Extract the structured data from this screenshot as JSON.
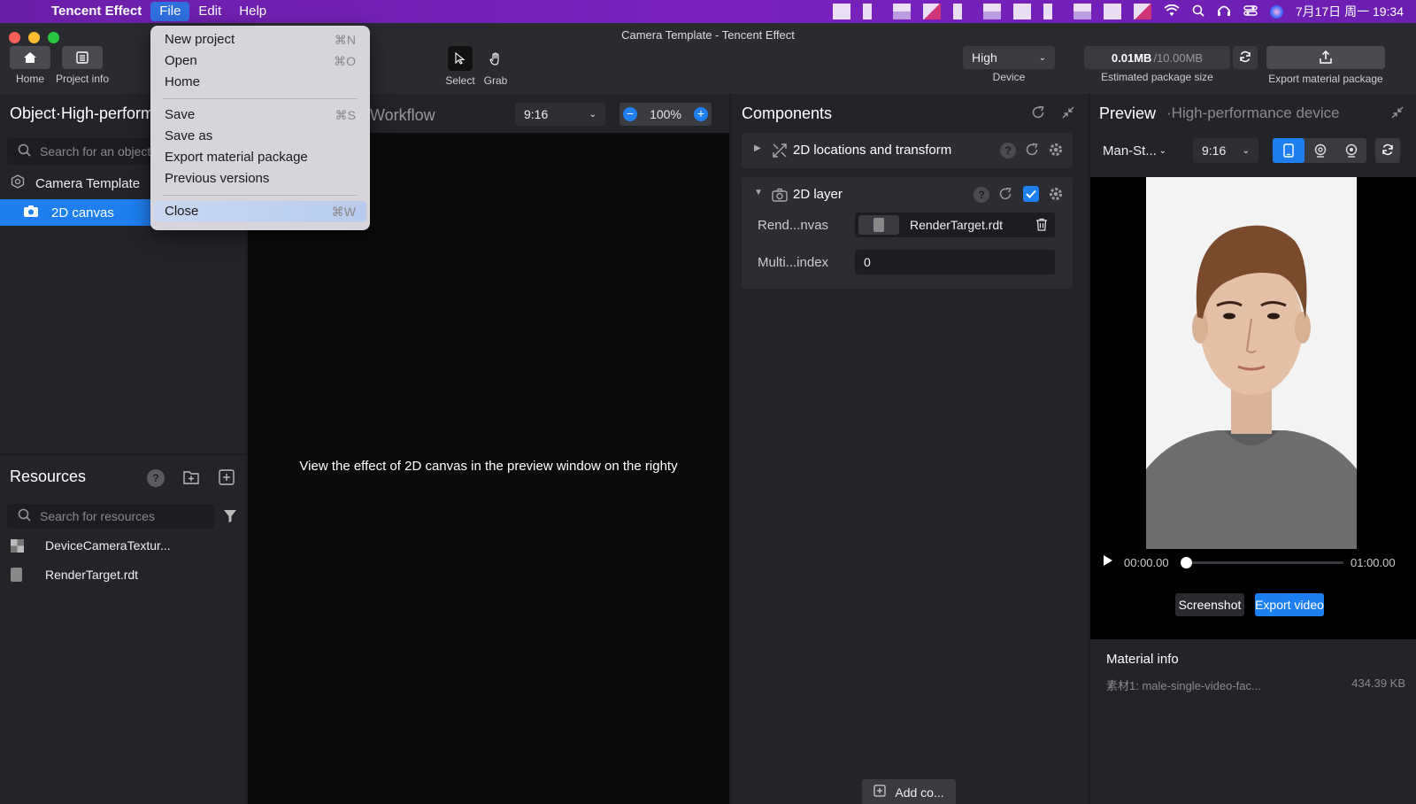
{
  "menubar": {
    "app_name": "Tencent Effect",
    "menus": [
      "File",
      "Edit",
      "Help"
    ],
    "clock": "7月17日 周一 19:34"
  },
  "window": {
    "title": "Camera Template - Tencent Effect"
  },
  "toolbar": {
    "home_label": "Home",
    "project_info_label": "Project info",
    "select_label": "Select",
    "grab_label": "Grab",
    "device_value": "High",
    "device_label": "Device",
    "package_size_value": "0.01MB",
    "package_size_limit": "/10.00MB",
    "package_size_label": "Estimated package size",
    "export_label": "Export material package"
  },
  "file_menu": {
    "items": [
      {
        "label": "New project",
        "shortcut": "⌘N"
      },
      {
        "label": "Open",
        "shortcut": "⌘O"
      },
      {
        "label": "Home",
        "shortcut": ""
      },
      {
        "label": "Save",
        "shortcut": "⌘S"
      },
      {
        "label": "Save as",
        "shortcut": ""
      },
      {
        "label": "Export material package",
        "shortcut": ""
      },
      {
        "label": "Previous versions",
        "shortcut": ""
      },
      {
        "label": "Close",
        "shortcut": "⌘W"
      }
    ]
  },
  "object_panel": {
    "title": "Object·High-perform",
    "search_placeholder": "Search for an object",
    "tree": [
      {
        "label": "Camera Template"
      },
      {
        "label": "2D canvas"
      }
    ]
  },
  "resources_panel": {
    "title": "Resources",
    "search_placeholder": "Search for resources",
    "items": [
      {
        "label": "DeviceCameraTextur..."
      },
      {
        "label": "RenderTarget.rdt"
      }
    ]
  },
  "workflow": {
    "title": "Workflow",
    "ratio": "9:16",
    "zoom": "100%",
    "message": "View the effect of 2D canvas in the preview window on the righty"
  },
  "components": {
    "title": "Components",
    "sections": [
      {
        "label": "2D locations and transform"
      },
      {
        "label": "2D layer"
      }
    ],
    "rend_label": "Rend...nvas",
    "rend_value": "RenderTarget.rdt",
    "multi_label": "Multi...index",
    "multi_value": "0",
    "add_label": "Add co..."
  },
  "preview": {
    "title": "Preview",
    "subtitle": "·High-performance device",
    "model": "Man-St...",
    "ratio": "9:16",
    "time_start": "00:00.00",
    "time_end": "01:00.00",
    "progress": 0,
    "screenshot_label": "Screenshot",
    "export_video_label": "Export video",
    "material_info_title": "Material info",
    "material_name": "素材1:  male-single-video-fac...",
    "material_size": "434.39 KB"
  },
  "colors": {
    "accent": "#1e7ff0",
    "menubar": "#7a22c0"
  }
}
